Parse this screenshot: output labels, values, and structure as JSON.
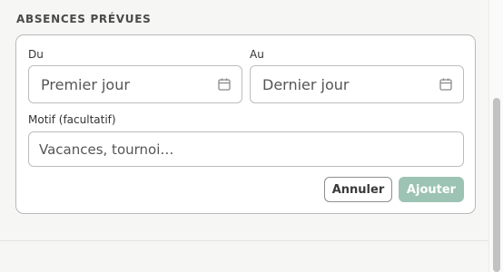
{
  "section": {
    "title": "ABSENCES PRÉVUES"
  },
  "form": {
    "start": {
      "label": "Du",
      "placeholder": "Premier jour"
    },
    "end": {
      "label": "Au",
      "placeholder": "Dernier jour"
    },
    "reason": {
      "label": "Motif (facultatif)",
      "placeholder": "Vacances, tournoi…"
    },
    "cancel_label": "Annuler",
    "submit_label": "Ajouter"
  },
  "icons": {
    "date_picker": "calendar-icon"
  },
  "colors": {
    "accent_disabled": "#9cc3b3",
    "border": "#b9b9b9",
    "background": "#f6f6f5"
  }
}
